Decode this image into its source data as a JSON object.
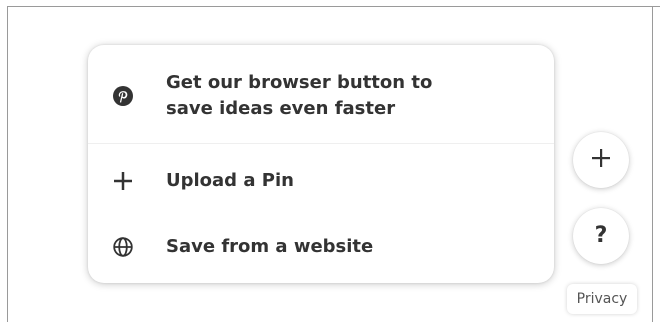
{
  "menu": {
    "items": [
      {
        "label": "Get our browser button to\nsave ideas even faster",
        "icon": "pinterest-logo-icon"
      },
      {
        "label": "Upload a Pin",
        "icon": "plus-icon"
      },
      {
        "label": "Save from a website",
        "icon": "globe-icon"
      }
    ]
  },
  "floating": {
    "plus_icon": "plus-icon",
    "help_label": "?",
    "privacy_label": "Privacy"
  },
  "colors": {
    "text": "#333333",
    "background": "#ffffff",
    "frame_border": "#9a9a9a"
  }
}
